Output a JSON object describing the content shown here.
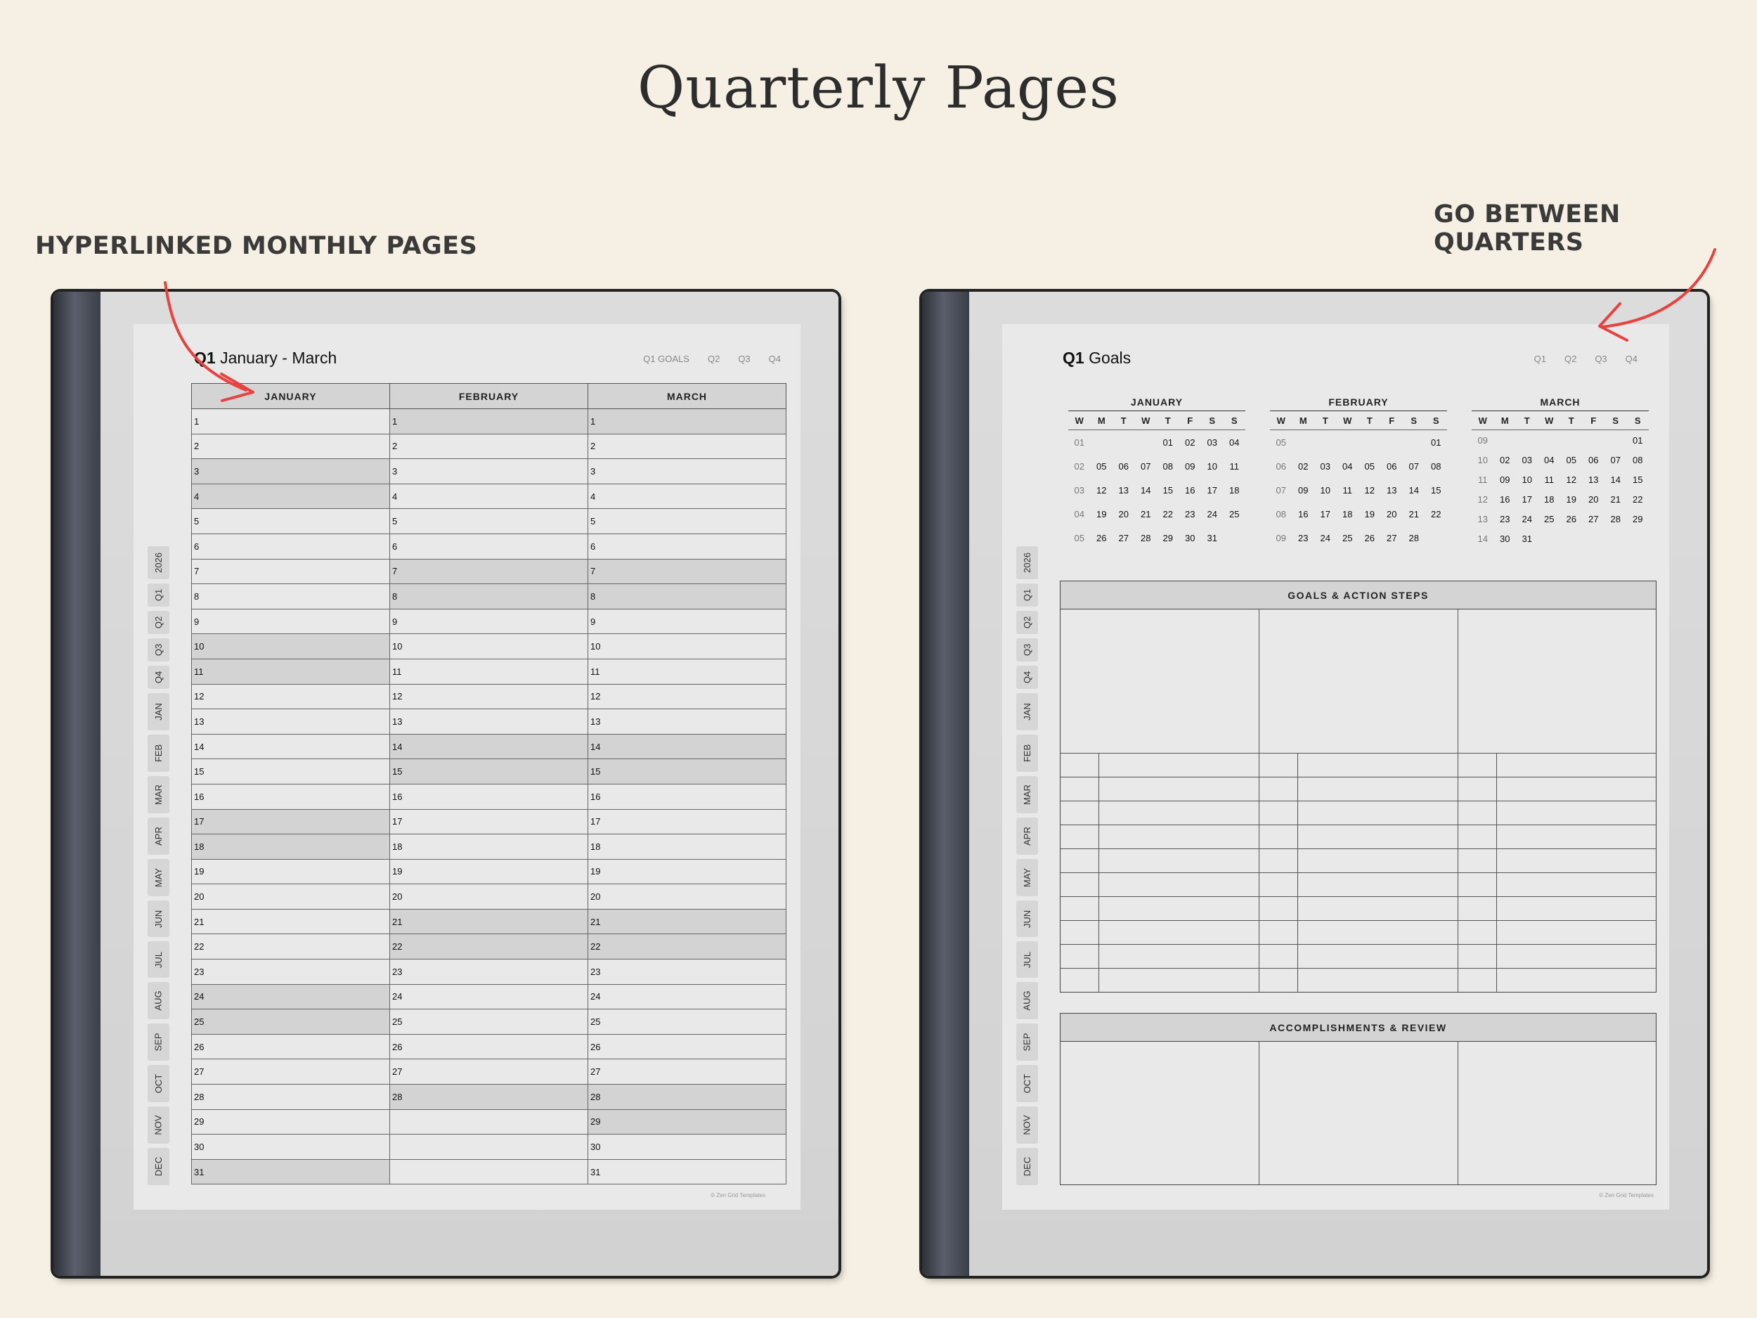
{
  "heading": "Quarterly Pages",
  "callouts": {
    "left": "HYPERLINKED MONTHLY PAGES",
    "right": "GO BETWEEN QUARTERS"
  },
  "colors": {
    "background": "#f6f0e4",
    "arrow": "#e8423f",
    "shade": "#d3d3d3"
  },
  "side_tabs": [
    "2026",
    "Q1",
    "Q2",
    "Q3",
    "Q4",
    "JAN",
    "FEB",
    "MAR",
    "APR",
    "MAY",
    "JUN",
    "JUL",
    "AUG",
    "SEP",
    "OCT",
    "NOV",
    "DEC"
  ],
  "left_page": {
    "title_bold": "Q1",
    "title_rest": "January - March",
    "nav": [
      "Q1 GOALS",
      "Q2",
      "Q3",
      "Q4"
    ],
    "months": [
      "JANUARY",
      "FEBRUARY",
      "MARCH"
    ],
    "days": [
      [
        "1",
        "1",
        "1"
      ],
      [
        "2",
        "2",
        "2"
      ],
      [
        "3",
        "3",
        "3"
      ],
      [
        "4",
        "4",
        "4"
      ],
      [
        "5",
        "5",
        "5"
      ],
      [
        "6",
        "6",
        "6"
      ],
      [
        "7",
        "7",
        "7"
      ],
      [
        "8",
        "8",
        "8"
      ],
      [
        "9",
        "9",
        "9"
      ],
      [
        "10",
        "10",
        "10"
      ],
      [
        "11",
        "11",
        "11"
      ],
      [
        "12",
        "12",
        "12"
      ],
      [
        "13",
        "13",
        "13"
      ],
      [
        "14",
        "14",
        "14"
      ],
      [
        "15",
        "15",
        "15"
      ],
      [
        "16",
        "16",
        "16"
      ],
      [
        "17",
        "17",
        "17"
      ],
      [
        "18",
        "18",
        "18"
      ],
      [
        "19",
        "19",
        "19"
      ],
      [
        "20",
        "20",
        "20"
      ],
      [
        "21",
        "21",
        "21"
      ],
      [
        "22",
        "22",
        "22"
      ],
      [
        "23",
        "23",
        "23"
      ],
      [
        "24",
        "24",
        "24"
      ],
      [
        "25",
        "25",
        "25"
      ],
      [
        "26",
        "26",
        "26"
      ],
      [
        "27",
        "27",
        "27"
      ],
      [
        "28",
        "28",
        "28"
      ],
      [
        "29",
        "",
        "29"
      ],
      [
        "30",
        "",
        "30"
      ],
      [
        "31",
        "",
        "31"
      ]
    ],
    "footer": "© Zen Grid Templates"
  },
  "right_page": {
    "title_bold": "Q1",
    "title_rest": "Goals",
    "nav": [
      "Q1",
      "Q2",
      "Q3",
      "Q4"
    ],
    "dow": [
      "W",
      "M",
      "T",
      "W",
      "T",
      "F",
      "S",
      "S"
    ],
    "mini_months": [
      {
        "name": "JANUARY",
        "weeks": [
          [
            "01",
            "",
            "",
            "",
            "01",
            "02",
            "03",
            "04"
          ],
          [
            "02",
            "05",
            "06",
            "07",
            "08",
            "09",
            "10",
            "11"
          ],
          [
            "03",
            "12",
            "13",
            "14",
            "15",
            "16",
            "17",
            "18"
          ],
          [
            "04",
            "19",
            "20",
            "21",
            "22",
            "23",
            "24",
            "25"
          ],
          [
            "05",
            "26",
            "27",
            "28",
            "29",
            "30",
            "31",
            ""
          ]
        ]
      },
      {
        "name": "FEBRUARY",
        "weeks": [
          [
            "05",
            "",
            "",
            "",
            "",
            "",
            "",
            "01"
          ],
          [
            "06",
            "02",
            "03",
            "04",
            "05",
            "06",
            "07",
            "08"
          ],
          [
            "07",
            "09",
            "10",
            "11",
            "12",
            "13",
            "14",
            "15"
          ],
          [
            "08",
            "16",
            "17",
            "18",
            "19",
            "20",
            "21",
            "22"
          ],
          [
            "09",
            "23",
            "24",
            "25",
            "26",
            "27",
            "28",
            ""
          ]
        ]
      },
      {
        "name": "MARCH",
        "weeks": [
          [
            "09",
            "",
            "",
            "",
            "",
            "",
            "",
            "01"
          ],
          [
            "10",
            "02",
            "03",
            "04",
            "05",
            "06",
            "07",
            "08"
          ],
          [
            "11",
            "09",
            "10",
            "11",
            "12",
            "13",
            "14",
            "15"
          ],
          [
            "12",
            "16",
            "17",
            "18",
            "19",
            "20",
            "21",
            "22"
          ],
          [
            "13",
            "23",
            "24",
            "25",
            "26",
            "27",
            "28",
            "29"
          ],
          [
            "14",
            "30",
            "31",
            "",
            "",
            "",
            "",
            ""
          ]
        ]
      }
    ],
    "goals_header": "GOALS & ACTION STEPS",
    "review_header": "ACCOMPLISHMENTS & REVIEW",
    "footer": "© Zen Grid Templates"
  }
}
